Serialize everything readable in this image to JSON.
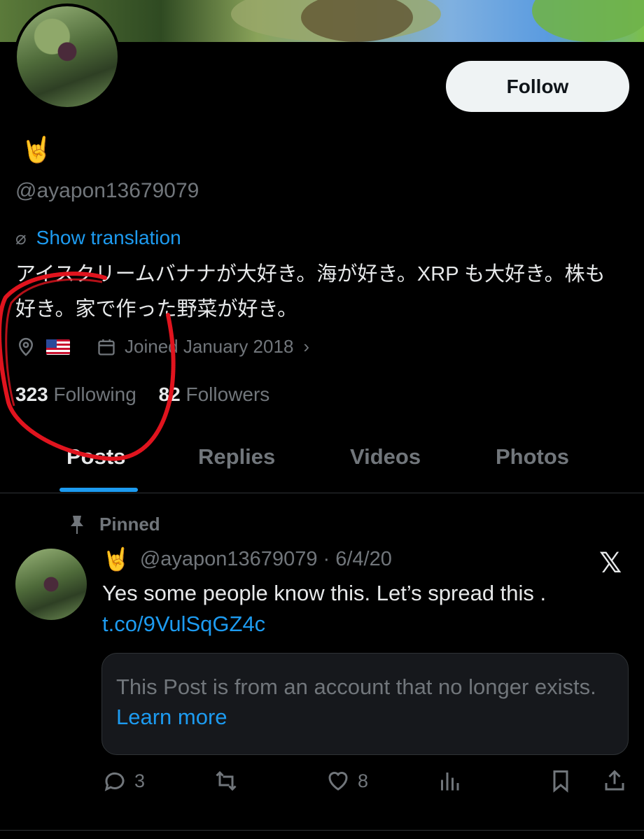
{
  "profile": {
    "display_emoji": "🤘",
    "handle": "@ayapon13679079",
    "follow_label": "Follow",
    "show_translation": "Show translation",
    "bio": "アイスクリームバナナが大好き。海が好き。XRP も大好き。株も好き。家で作った野菜が好き。",
    "location_flag": "🇺🇸",
    "joined": "Joined January 2018",
    "following_count": "323",
    "following_label": "Following",
    "followers_count": "82",
    "followers_label": "Followers"
  },
  "tabs": [
    {
      "label": "Posts",
      "active": true
    },
    {
      "label": "Replies",
      "active": false
    },
    {
      "label": "Videos",
      "active": false
    },
    {
      "label": "Photos",
      "active": false
    }
  ],
  "post": {
    "pinned_label": "Pinned",
    "author_emoji": "🤘",
    "meta": "@ayapon13679079 · 6/4/20",
    "text": "Yes some people know this. Let’s spread this .",
    "link": "t.co/9VulSqGZ4c",
    "notice_text": "This Post is from an account that no longer exists.",
    "notice_link": "Learn more",
    "replies": "3",
    "likes": "8"
  },
  "colors": {
    "accent": "#1d9bf0",
    "muted": "#71767b",
    "annotation": "#e0141e"
  }
}
